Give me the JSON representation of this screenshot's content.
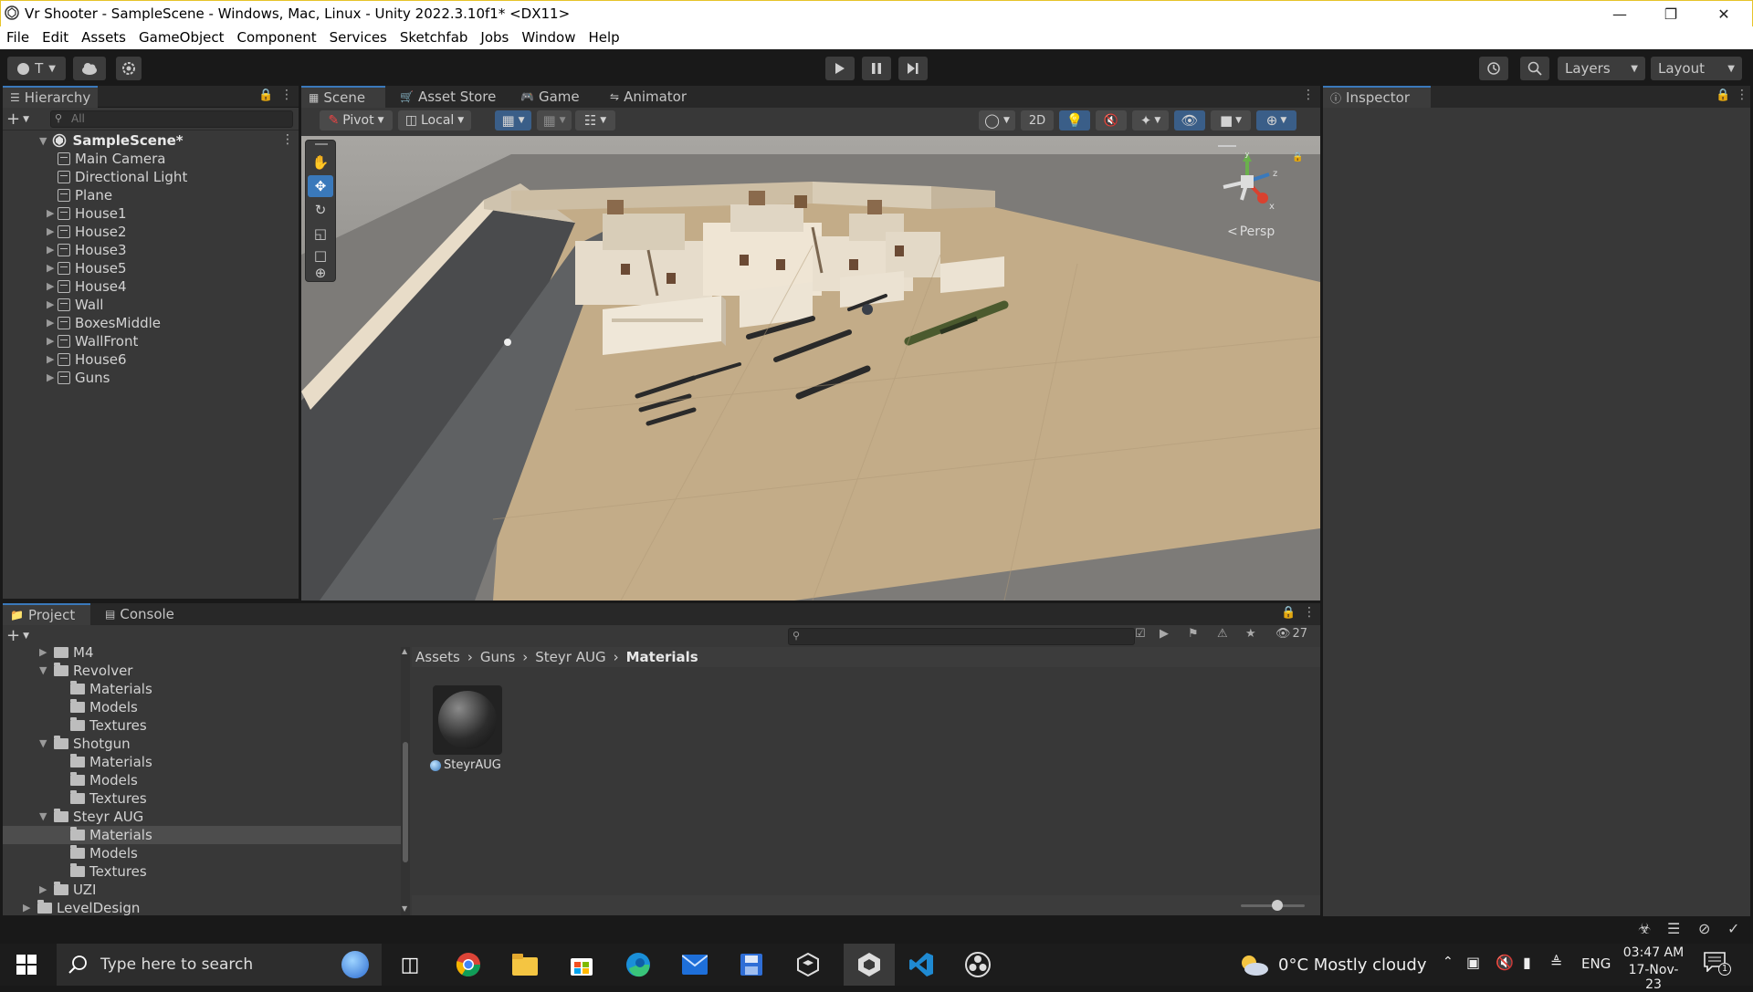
{
  "window": {
    "title": "Vr Shooter - SampleScene - Windows, Mac, Linux - Unity 2022.3.10f1* <DX11>"
  },
  "menu": [
    "File",
    "Edit",
    "Assets",
    "GameObject",
    "Component",
    "Services",
    "Sketchfab",
    "Jobs",
    "Window",
    "Help"
  ],
  "toolbar": {
    "account_label": "T",
    "layers_label": "Layers",
    "layout_label": "Layout"
  },
  "hierarchy": {
    "tab_label": "Hierarchy",
    "search_placeholder": "All",
    "scene_name": "SampleScene*",
    "items": [
      {
        "label": "Main Camera",
        "expandable": false
      },
      {
        "label": "Directional Light",
        "expandable": false
      },
      {
        "label": "Plane",
        "expandable": false
      },
      {
        "label": "House1",
        "expandable": true
      },
      {
        "label": "House2",
        "expandable": true
      },
      {
        "label": "House3",
        "expandable": true
      },
      {
        "label": "House5",
        "expandable": true
      },
      {
        "label": "House4",
        "expandable": true
      },
      {
        "label": "Wall",
        "expandable": true
      },
      {
        "label": "BoxesMiddle",
        "expandable": true
      },
      {
        "label": "WallFront",
        "expandable": true
      },
      {
        "label": "House6",
        "expandable": true
      },
      {
        "label": "Guns",
        "expandable": true
      }
    ]
  },
  "scene_tabs": [
    "Scene",
    "Asset Store",
    "Game",
    "Animator"
  ],
  "scene_toolbar": {
    "pivot_label": "Pivot",
    "local_label": "Local",
    "mode_2d": "2D"
  },
  "gizmo": {
    "persp_label": "Persp",
    "axis_x": "x",
    "axis_y": "y",
    "axis_z": "z"
  },
  "inspector": {
    "tab_label": "Inspector"
  },
  "project": {
    "tabs": [
      "Project",
      "Console"
    ],
    "hidden_count": "27",
    "breadcrumb": [
      "Assets",
      "Guns",
      "Steyr AUG",
      "Materials"
    ],
    "tree": [
      {
        "label": "M4",
        "depth": 1,
        "arrow": "closed"
      },
      {
        "label": "Revolver",
        "depth": 1,
        "arrow": "open"
      },
      {
        "label": "Materials",
        "depth": 2,
        "arrow": "none"
      },
      {
        "label": "Models",
        "depth": 2,
        "arrow": "none"
      },
      {
        "label": "Textures",
        "depth": 2,
        "arrow": "none"
      },
      {
        "label": "Shotgun",
        "depth": 1,
        "arrow": "open"
      },
      {
        "label": "Materials",
        "depth": 2,
        "arrow": "none"
      },
      {
        "label": "Models",
        "depth": 2,
        "arrow": "none"
      },
      {
        "label": "Textures",
        "depth": 2,
        "arrow": "none"
      },
      {
        "label": "Steyr AUG",
        "depth": 1,
        "arrow": "open"
      },
      {
        "label": "Materials",
        "depth": 2,
        "arrow": "none",
        "selected": true
      },
      {
        "label": "Models",
        "depth": 2,
        "arrow": "none"
      },
      {
        "label": "Textures",
        "depth": 2,
        "arrow": "none"
      },
      {
        "label": "UZI",
        "depth": 1,
        "arrow": "closed"
      },
      {
        "label": "LevelDesign",
        "depth": 0,
        "arrow": "closed"
      }
    ],
    "asset": {
      "label": "SteyrAUG"
    }
  },
  "taskbar": {
    "search_placeholder": "Type here to search",
    "weather": "0°C  Mostly cloudy",
    "language": "ENG",
    "time": "03:47 AM",
    "date": "17-Nov-23",
    "notification_count": "1"
  },
  "colors": {
    "accent": "#3a79bb",
    "panel": "#383838",
    "dark": "#191919",
    "selection": "#4d4d4d"
  }
}
